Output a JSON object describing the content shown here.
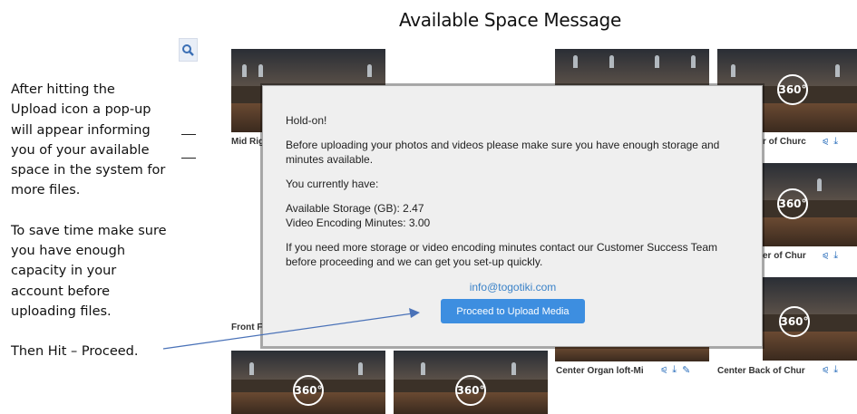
{
  "slide": {
    "title": "Available Space Message",
    "instructions": {
      "p1": [
        "After hitting the",
        "Upload icon a pop-up",
        "will appear informing",
        "you of your available",
        "space in the system for",
        "more files."
      ],
      "p2": [
        "To save time make sure",
        "you have enough",
        "capacity in your",
        "account before",
        "uploading files."
      ],
      "p3": "Then Hit – Proceed."
    }
  },
  "search": {
    "icon": "magnifier-icon"
  },
  "gallery": {
    "badge": "360°",
    "captions": {
      "top_left": "Mid Rig",
      "mid_left": "Front F",
      "top_right": "r of Churc",
      "mid_right": "er of Chur",
      "bottom_center": "Center Organ loft-Mi",
      "bottom_right": "Center Back of Chur"
    },
    "action_icons": [
      "share-icon",
      "download-icon",
      "edit-icon"
    ]
  },
  "popup": {
    "heading": "Hold-on!",
    "intro": "Before uploading your photos and videos please make sure you have enough storage and minutes available.",
    "have": "You currently have:",
    "storage_label": "Available Storage (GB): 2.47",
    "minutes_label": "Video Encoding Minutes: 3.00",
    "contact": "If you need more storage or video encoding minutes contact our Customer Success Team before proceeding and we can get you set-up quickly.",
    "email": "info@togotiki.com",
    "button": "Proceed to Upload Media"
  },
  "colors": {
    "accent": "#3d8ee0",
    "link": "#3a82c8",
    "arrow": "#4a72b8"
  }
}
